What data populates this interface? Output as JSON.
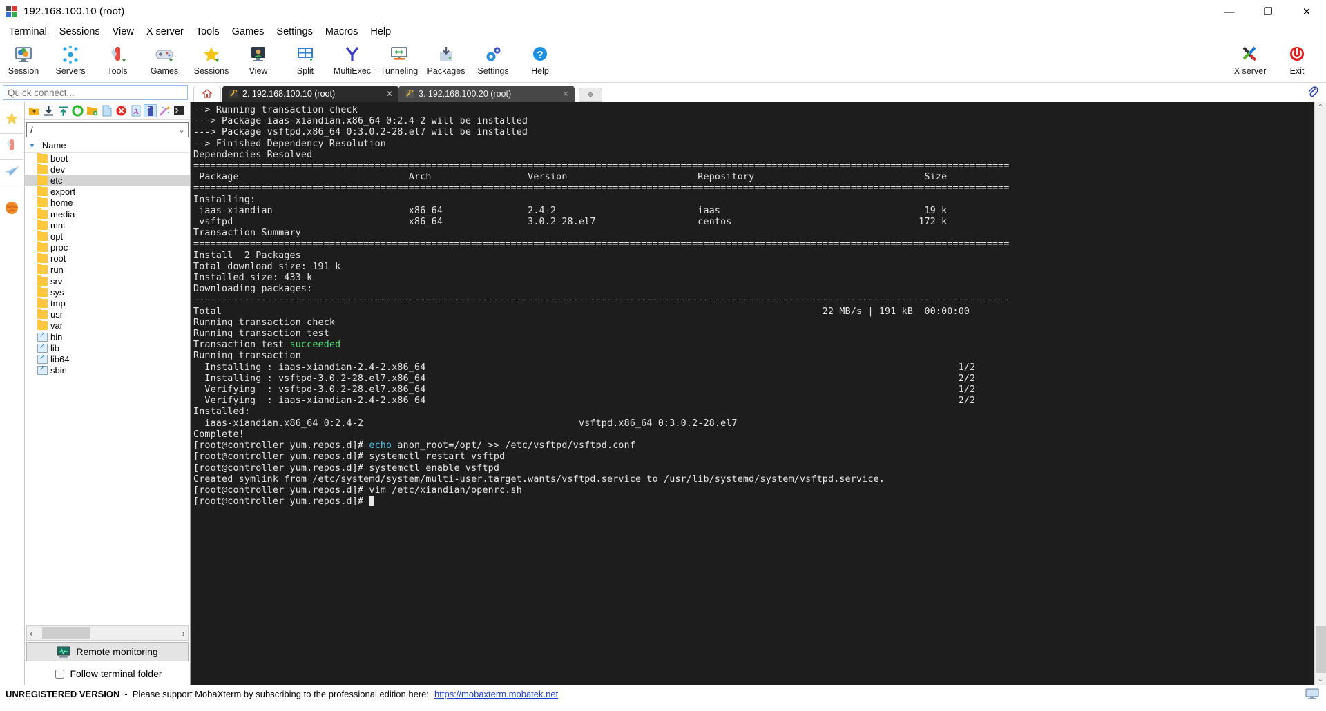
{
  "window": {
    "title": "192.168.100.10 (root)",
    "minimize": "—",
    "maximize": "❐",
    "close": "✕"
  },
  "menubar": {
    "items": [
      {
        "label": "Terminal"
      },
      {
        "label": "Sessions"
      },
      {
        "label": "View"
      },
      {
        "label": "X server"
      },
      {
        "label": "Tools"
      },
      {
        "label": "Games"
      },
      {
        "label": "Settings"
      },
      {
        "label": "Macros"
      },
      {
        "label": "Help"
      }
    ]
  },
  "toolbar": {
    "buttons": [
      {
        "label": "Session",
        "icon": "session-icon"
      },
      {
        "label": "Servers",
        "icon": "servers-icon"
      },
      {
        "label": "Tools",
        "icon": "tools-icon"
      },
      {
        "label": "Games",
        "icon": "games-icon"
      },
      {
        "label": "Sessions",
        "icon": "sessions-star-icon"
      },
      {
        "label": "View",
        "icon": "view-icon"
      },
      {
        "label": "Split",
        "icon": "split-icon"
      },
      {
        "label": "MultiExec",
        "icon": "multiexec-icon"
      },
      {
        "label": "Tunneling",
        "icon": "tunneling-icon"
      },
      {
        "label": "Packages",
        "icon": "packages-icon"
      },
      {
        "label": "Settings",
        "icon": "settings-gear-icon"
      },
      {
        "label": "Help",
        "icon": "help-question-icon"
      }
    ],
    "right_buttons": [
      {
        "label": "X server",
        "icon": "xserver-icon"
      },
      {
        "label": "Exit",
        "icon": "exit-power-icon"
      }
    ]
  },
  "quick_connect": {
    "placeholder": "Quick connect..."
  },
  "rail": {
    "items": [
      {
        "name": "favorites",
        "icon": "star-icon"
      },
      {
        "name": "tools",
        "icon": "swiss-knife-icon"
      },
      {
        "name": "send",
        "icon": "paper-plane-icon"
      },
      {
        "name": "globe",
        "icon": "globe-icon"
      }
    ]
  },
  "sftp": {
    "toolbar_icons": [
      "parent-folder-icon",
      "download-icon",
      "upload-icon",
      "refresh-icon",
      "new-folder-icon",
      "new-file-icon",
      "delete-icon",
      "text-mode-icon",
      "binary-mode-icon",
      "wizard-icon",
      "terminal-icon"
    ],
    "path": "/",
    "path_caret": "⌄",
    "column_header": "Name",
    "sort_arrow": "▼",
    "entries": [
      {
        "name": "boot",
        "type": "folder",
        "selected": false
      },
      {
        "name": "dev",
        "type": "folder",
        "selected": false
      },
      {
        "name": "etc",
        "type": "folder",
        "selected": true
      },
      {
        "name": "export",
        "type": "folder",
        "selected": false
      },
      {
        "name": "home",
        "type": "folder",
        "selected": false
      },
      {
        "name": "media",
        "type": "folder",
        "selected": false
      },
      {
        "name": "mnt",
        "type": "folder",
        "selected": false
      },
      {
        "name": "opt",
        "type": "folder",
        "selected": false
      },
      {
        "name": "proc",
        "type": "folder",
        "selected": false
      },
      {
        "name": "root",
        "type": "folder",
        "selected": false
      },
      {
        "name": "run",
        "type": "folder",
        "selected": false
      },
      {
        "name": "srv",
        "type": "folder",
        "selected": false
      },
      {
        "name": "sys",
        "type": "folder",
        "selected": false
      },
      {
        "name": "tmp",
        "type": "folder",
        "selected": false
      },
      {
        "name": "usr",
        "type": "folder",
        "selected": false
      },
      {
        "name": "var",
        "type": "folder",
        "selected": false
      },
      {
        "name": "bin",
        "type": "link",
        "selected": false
      },
      {
        "name": "lib",
        "type": "link",
        "selected": false
      },
      {
        "name": "lib64",
        "type": "link",
        "selected": false
      },
      {
        "name": "sbin",
        "type": "link",
        "selected": false
      }
    ],
    "hscroll_left": "‹",
    "hscroll_right": "›",
    "remote_monitoring": "Remote monitoring",
    "follow_terminal_folder": "Follow terminal folder",
    "follow_checked": false
  },
  "tabs": {
    "home_icon": "home-icon",
    "items": [
      {
        "label": "2. 192.168.100.10 (root)",
        "active": true,
        "close": "✕"
      },
      {
        "label": "3. 192.168.100.20 (root)",
        "active": false,
        "close": "✕"
      }
    ],
    "new_tab": "✥"
  },
  "terminal": {
    "lines": [
      {
        "segments": [
          {
            "t": "--> Running transaction check"
          }
        ]
      },
      {
        "segments": [
          {
            "t": "---> Package iaas-xiandian.x86_64 0:2.4-2 will be installed"
          }
        ]
      },
      {
        "segments": [
          {
            "t": "---> Package vsftpd.x86_64 0:3.0.2-28.el7 will be installed"
          }
        ]
      },
      {
        "segments": [
          {
            "t": "--> Finished Dependency Resolution"
          }
        ]
      },
      {
        "segments": [
          {
            "t": ""
          }
        ]
      },
      {
        "segments": [
          {
            "t": "Dependencies Resolved"
          }
        ]
      },
      {
        "segments": [
          {
            "t": ""
          }
        ]
      },
      {
        "segments": [
          {
            "t": "================================================================================================================================================"
          }
        ]
      },
      {
        "segments": [
          {
            "t": " Package                              Arch                 Version                       Repository                              Size"
          }
        ]
      },
      {
        "segments": [
          {
            "t": "================================================================================================================================================"
          }
        ]
      },
      {
        "segments": [
          {
            "t": "Installing:"
          }
        ]
      },
      {
        "segments": [
          {
            "t": " iaas-xiandian                        x86_64               2.4-2                         iaas                                    19 k"
          }
        ]
      },
      {
        "segments": [
          {
            "t": " vsftpd                               x86_64               3.0.2-28.el7                  centos                                 172 k"
          }
        ]
      },
      {
        "segments": [
          {
            "t": ""
          }
        ]
      },
      {
        "segments": [
          {
            "t": "Transaction Summary"
          }
        ]
      },
      {
        "segments": [
          {
            "t": "================================================================================================================================================"
          }
        ]
      },
      {
        "segments": [
          {
            "t": "Install  2 Packages"
          }
        ]
      },
      {
        "segments": [
          {
            "t": ""
          }
        ]
      },
      {
        "segments": [
          {
            "t": "Total download size: 191 k"
          }
        ]
      },
      {
        "segments": [
          {
            "t": "Installed size: 433 k"
          }
        ]
      },
      {
        "segments": [
          {
            "t": "Downloading packages:"
          }
        ]
      },
      {
        "segments": [
          {
            "t": "------------------------------------------------------------------------------------------------------------------------------------------------"
          }
        ]
      },
      {
        "segments": [
          {
            "t": "Total                                                                                                          22 MB/s | 191 kB  00:00:00"
          }
        ]
      },
      {
        "segments": [
          {
            "t": "Running transaction check"
          }
        ]
      },
      {
        "segments": [
          {
            "t": "Running transaction test"
          }
        ]
      },
      {
        "segments": [
          {
            "t": "Transaction test "
          },
          {
            "t": "succeeded",
            "c": "green"
          }
        ]
      },
      {
        "segments": [
          {
            "t": "Running transaction"
          }
        ]
      },
      {
        "segments": [
          {
            "t": "  Installing : iaas-xiandian-2.4-2.x86_64                                                                                              1/2"
          }
        ]
      },
      {
        "segments": [
          {
            "t": "  Installing : vsftpd-3.0.2-28.el7.x86_64                                                                                              2/2"
          }
        ]
      },
      {
        "segments": [
          {
            "t": "  Verifying  : vsftpd-3.0.2-28.el7.x86_64                                                                                              1/2"
          }
        ]
      },
      {
        "segments": [
          {
            "t": "  Verifying  : iaas-xiandian-2.4-2.x86_64                                                                                              2/2"
          }
        ]
      },
      {
        "segments": [
          {
            "t": ""
          }
        ]
      },
      {
        "segments": [
          {
            "t": "Installed:"
          }
        ]
      },
      {
        "segments": [
          {
            "t": "  iaas-xiandian.x86_64 0:2.4-2                                      vsftpd.x86_64 0:3.0.2-28.el7"
          }
        ]
      },
      {
        "segments": [
          {
            "t": ""
          }
        ]
      },
      {
        "segments": [
          {
            "t": "Complete!"
          }
        ]
      },
      {
        "segments": [
          {
            "t": "[root@controller yum.repos.d]# "
          },
          {
            "t": "echo",
            "c": "cyan"
          },
          {
            "t": " anon_root=/opt/ >> /etc/vsftpd/vsftpd.conf"
          }
        ]
      },
      {
        "segments": [
          {
            "t": "[root@controller yum.repos.d]# systemctl restart vsftpd"
          }
        ]
      },
      {
        "segments": [
          {
            "t": "[root@controller yum.repos.d]# systemctl enable vsftpd"
          }
        ]
      },
      {
        "segments": [
          {
            "t": "Created symlink from /etc/systemd/system/multi-user.target.wants/vsftpd.service to /usr/lib/systemd/system/vsftpd.service."
          }
        ]
      },
      {
        "segments": [
          {
            "t": "[root@controller yum.repos.d]# vim /etc/xiandian/openrc.sh"
          }
        ]
      },
      {
        "segments": [
          {
            "t": "[root@controller yum.repos.d]# "
          },
          {
            "t": "",
            "cursor": true
          }
        ]
      }
    ],
    "scroll_up": "⌃",
    "scroll_down": "⌄"
  },
  "statusbar": {
    "unregistered": "UNREGISTERED VERSION",
    "dash": "-",
    "message": "Please support MobaXterm by subscribing to the professional edition here:",
    "link": "https://mobaxterm.mobatek.net"
  },
  "colors": {
    "terminal_bg": "#1d1d1d",
    "terminal_fg": "#e6e6e6",
    "green": "#4ee07a",
    "cyan": "#4fc3e8",
    "tab_active": "#2b2b2b",
    "selection": "#d4d4d4",
    "link": "#1a3fd0",
    "folder": "#ffc83d"
  }
}
